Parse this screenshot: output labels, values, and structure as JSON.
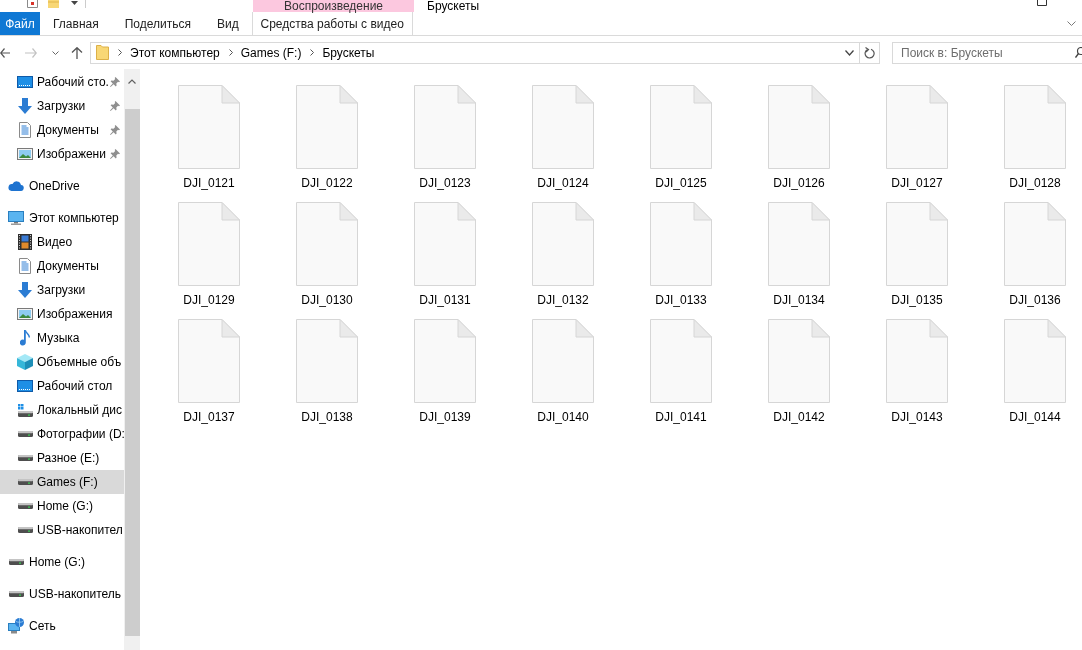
{
  "window": {
    "title": "Брускеты"
  },
  "ribbon": {
    "contextual_group": "Воспроизведение",
    "file_button": "Файл",
    "tabs": [
      {
        "label": "Главная",
        "kind": "normal",
        "selected": false
      },
      {
        "label": "Поделиться",
        "kind": "normal",
        "selected": false
      },
      {
        "label": "Вид",
        "kind": "normal",
        "selected": false
      },
      {
        "label": "Средства работы с видео",
        "kind": "contextual",
        "selected": false
      }
    ]
  },
  "address_bar": {
    "path": [
      "Этот компьютер",
      "Games (F:)",
      "Брускеты"
    ]
  },
  "search": {
    "placeholder": "Поиск в: Брускеты"
  },
  "navigation": {
    "quick_access": [
      {
        "label": "Рабочий сто.",
        "kind": "desktop",
        "pinned": true,
        "selected": false
      },
      {
        "label": "Загрузки",
        "kind": "downloads",
        "pinned": true,
        "selected": false
      },
      {
        "label": "Документы",
        "kind": "documents",
        "pinned": true,
        "selected": false
      },
      {
        "label": "Изображени",
        "kind": "pictures",
        "pinned": true,
        "selected": false
      }
    ],
    "tree": [
      {
        "label": "OneDrive",
        "kind": "cloud",
        "selected": false
      },
      {
        "label": "Этот компьютер",
        "kind": "computer",
        "selected": false,
        "children": [
          {
            "label": "Видео",
            "kind": "videos",
            "selected": false
          },
          {
            "label": "Документы",
            "kind": "documents",
            "selected": false
          },
          {
            "label": "Загрузки",
            "kind": "downloads",
            "selected": false
          },
          {
            "label": "Изображения",
            "kind": "pictures",
            "selected": false
          },
          {
            "label": "Музыка",
            "kind": "music",
            "selected": false
          },
          {
            "label": "Объемные объ",
            "kind": "objects3d",
            "selected": false
          },
          {
            "label": "Рабочий стол",
            "kind": "desktop",
            "selected": false
          },
          {
            "label": "Локальный дис",
            "kind": "system-drive",
            "selected": false
          },
          {
            "label": "Фотографии (D:",
            "kind": "drive",
            "selected": false
          },
          {
            "label": "Разное (E:)",
            "kind": "drive",
            "selected": false
          },
          {
            "label": "Games (F:)",
            "kind": "drive",
            "selected": true
          },
          {
            "label": "Home (G:)",
            "kind": "drive",
            "selected": false
          },
          {
            "label": "USB-накопител",
            "kind": "drive",
            "selected": false
          }
        ]
      },
      {
        "label": "Home (G:)",
        "kind": "drive",
        "selected": false
      },
      {
        "label": "USB-накопитель",
        "kind": "drive",
        "selected": false
      },
      {
        "label": "Сеть",
        "kind": "network",
        "selected": false
      }
    ]
  },
  "files": [
    {
      "name": "DJI_0121",
      "selected": false
    },
    {
      "name": "DJI_0122",
      "selected": false
    },
    {
      "name": "DJI_0123",
      "selected": false
    },
    {
      "name": "DJI_0124",
      "selected": false
    },
    {
      "name": "DJI_0125",
      "selected": false
    },
    {
      "name": "DJI_0126",
      "selected": false
    },
    {
      "name": "DJI_0127",
      "selected": false
    },
    {
      "name": "DJI_0128",
      "selected": false
    },
    {
      "name": "DJI_0129",
      "selected": false
    },
    {
      "name": "DJI_0130",
      "selected": false
    },
    {
      "name": "DJI_0131",
      "selected": false
    },
    {
      "name": "DJI_0132",
      "selected": false
    },
    {
      "name": "DJI_0133",
      "selected": false
    },
    {
      "name": "DJI_0134",
      "selected": false
    },
    {
      "name": "DJI_0135",
      "selected": false
    },
    {
      "name": "DJI_0136",
      "selected": false
    },
    {
      "name": "DJI_0137",
      "selected": false
    },
    {
      "name": "DJI_0138",
      "selected": false
    },
    {
      "name": "DJI_0139",
      "selected": false
    },
    {
      "name": "DJI_0140",
      "selected": false
    },
    {
      "name": "DJI_0141",
      "selected": false
    },
    {
      "name": "DJI_0142",
      "selected": false
    },
    {
      "name": "DJI_0143",
      "selected": false
    },
    {
      "name": "DJI_0144",
      "selected": false
    }
  ]
}
